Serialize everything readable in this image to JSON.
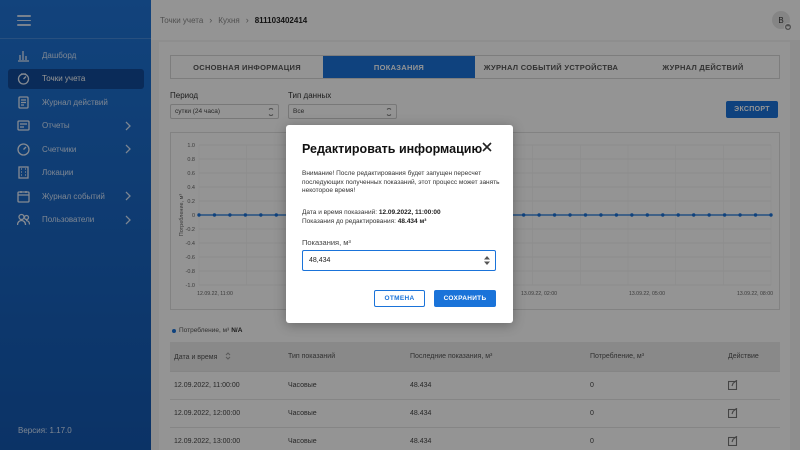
{
  "sidebar": {
    "items": [
      {
        "label": "Дашборд",
        "icon": "bar-chart-icon"
      },
      {
        "label": "Точки учета",
        "icon": "meter-icon"
      },
      {
        "label": "Журнал действий",
        "icon": "journal-icon"
      },
      {
        "label": "Отчеты",
        "icon": "report-icon"
      },
      {
        "label": "Счетчики",
        "icon": "gauge-icon"
      },
      {
        "label": "Локации",
        "icon": "building-icon"
      },
      {
        "label": "Журнал событий",
        "icon": "calendar-icon"
      },
      {
        "label": "Пользователи",
        "icon": "users-icon"
      }
    ],
    "version": "Версия: 1.17.0"
  },
  "header": {
    "crumb1": "Точки учета",
    "crumb2": "Кухня",
    "crumb3": "811103402414",
    "avatar": "B"
  },
  "tabs": [
    "ОСНОВНАЯ ИНФОРМАЦИЯ",
    "ПОКАЗАНИЯ",
    "ЖУРНАЛ СОБЫТИЙ УСТРОЙСТВА",
    "ЖУРНАЛ ДЕЙСТВИЙ"
  ],
  "filters": {
    "period_label": "Период",
    "period_value": "сутки (24 часа)",
    "type_label": "Тип данных",
    "type_value": "Все",
    "export_label": "ЭКСПОРТ"
  },
  "chart_data": {
    "type": "line",
    "ylabel": "Потребление, м³",
    "ylim": [
      -1.0,
      1.0
    ],
    "yticks": [
      "1.0",
      "0.8",
      "0.6",
      "0.4",
      "0.2",
      "0",
      "-0.2",
      "-0.4",
      "-0.6",
      "-0.8",
      "-1.0"
    ],
    "xticks": [
      "12.09.22, 11:00",
      "12.09.22,",
      "12.09.22, 23:00",
      "13.09.22, 02:00",
      "13.09.22, 05:00",
      "13.09.22, 08:00"
    ],
    "series": [
      {
        "name": "Потребление, м³",
        "values": [
          0,
          0,
          0,
          0,
          0,
          0,
          0,
          0,
          0,
          0,
          0,
          0,
          0,
          0,
          0,
          0,
          0,
          0,
          0,
          0,
          0,
          0,
          0,
          0,
          0,
          0,
          0,
          0,
          0,
          0,
          0,
          0,
          0,
          0,
          0,
          0,
          0,
          0
        ]
      }
    ],
    "legend_text": "Потребление, м³",
    "legend_value": "N/A",
    "grid": true,
    "color": "#1a73d9"
  },
  "table": {
    "headers": [
      "Дата и время",
      "Тип показаний",
      "Последние показания, м³",
      "Потребление, м³",
      "Действие"
    ],
    "rows": [
      [
        "12.09.2022, 11:00:00",
        "Часовые",
        "48.434",
        "0"
      ],
      [
        "12.09.2022, 12:00:00",
        "Часовые",
        "48.434",
        "0"
      ],
      [
        "12.09.2022, 13:00:00",
        "Часовые",
        "48.434",
        "0"
      ]
    ]
  },
  "modal": {
    "title": "Редактировать информацию",
    "warning": "Внимание! После редактирования будет запущен пересчет последующих полученных показаний, этот процесс может занять некоторое время!",
    "date_label": "Дата и время показаний:",
    "date_value": "12.09.2022, 11:00:00",
    "before_label": "Показания до редактирования:",
    "before_value": "48.434 м³",
    "field_label": "Показания, м³",
    "field_value": "48,434",
    "cancel": "ОТМЕНА",
    "save": "СОХРАНИТЬ"
  },
  "colors": {
    "primary": "#1a73d9",
    "sidebar": "#1f74d6"
  }
}
